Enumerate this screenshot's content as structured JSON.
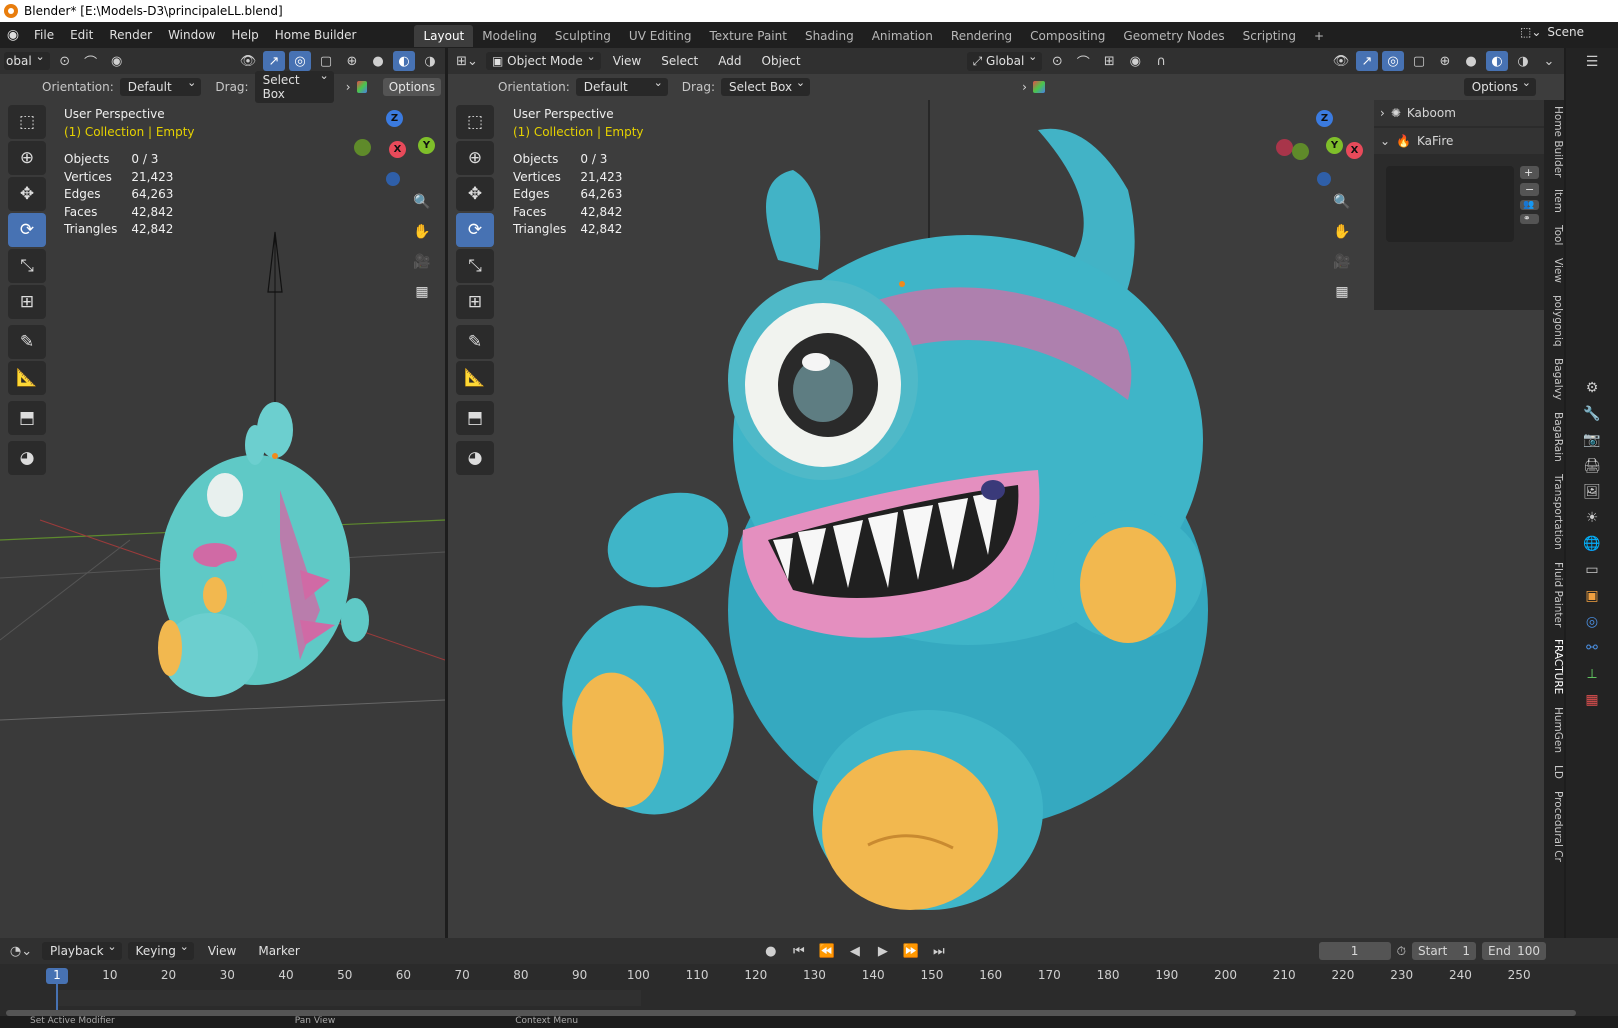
{
  "window": {
    "title": "Blender* [E:\\Models-D3\\principaleLL.blend]"
  },
  "menubar": {
    "items": [
      "File",
      "Edit",
      "Render",
      "Window",
      "Help",
      "Home Builder"
    ]
  },
  "workspaces": [
    "Layout",
    "Modeling",
    "Sculpting",
    "UV Editing",
    "Texture Paint",
    "Shading",
    "Animation",
    "Rendering",
    "Compositing",
    "Geometry Nodes",
    "Scripting"
  ],
  "active_workspace": "Layout",
  "scene": {
    "label": "Scene"
  },
  "left_viewport": {
    "header": {
      "global_partial": "obal"
    },
    "tool_header": {
      "orientation_label": "Orientation:",
      "orientation_value": "Default",
      "drag_label": "Drag:",
      "drag_value": "Select Box",
      "options": "Options"
    },
    "overlay": {
      "perspective": "User Perspective",
      "collection": "(1) Collection | Empty"
    },
    "stats": {
      "objects_label": "Objects",
      "objects": "0 / 3",
      "vertices_label": "Vertices",
      "vertices": "21,423",
      "edges_label": "Edges",
      "edges": "64,263",
      "faces_label": "Faces",
      "faces": "42,842",
      "triangles_label": "Triangles",
      "triangles": "42,842"
    },
    "gizmo": {
      "z": "Z",
      "y": "Y",
      "x": "X"
    }
  },
  "main_viewport": {
    "header": {
      "mode": "Object Mode",
      "menus": [
        "View",
        "Select",
        "Add",
        "Object"
      ],
      "transform": "Global"
    },
    "tool_header": {
      "orientation_label": "Orientation:",
      "orientation_value": "Default",
      "drag_label": "Drag:",
      "drag_value": "Select Box",
      "options": "Options"
    },
    "overlay": {
      "perspective": "User Perspective",
      "collection": "(1) Collection | Empty"
    },
    "stats": {
      "objects_label": "Objects",
      "objects": "0 / 3",
      "vertices_label": "Vertices",
      "vertices": "21,423",
      "edges_label": "Edges",
      "edges": "64,263",
      "faces_label": "Faces",
      "faces": "42,842",
      "triangles_label": "Triangles",
      "triangles": "42,842"
    },
    "gizmo": {
      "z": "Z",
      "y": "Y",
      "x": "X"
    }
  },
  "npanel": {
    "panels": [
      "Kaboom",
      "KaFire"
    ],
    "tabs": [
      "Home Builder",
      "Item",
      "Tool",
      "View",
      "polygoniq",
      "Bagalvy",
      "BagaRain",
      "Transportation",
      "Fluid Painter",
      "FRACTURE",
      "HumGen",
      "LD",
      "Procedural Cr"
    ]
  },
  "timeline": {
    "menus": {
      "playback": "Playback",
      "keying": "Keying",
      "view": "View",
      "marker": "Marker"
    },
    "current_frame": "1",
    "start_label": "Start",
    "start": "1",
    "end_label": "End",
    "end": "100",
    "ruler": [
      "1",
      "10",
      "20",
      "30",
      "40",
      "50",
      "60",
      "70",
      "80",
      "90",
      "100",
      "110",
      "120",
      "130",
      "140",
      "150",
      "160",
      "170",
      "180",
      "190",
      "200",
      "210",
      "220",
      "230",
      "240",
      "250"
    ]
  },
  "statusbar": {
    "items": [
      "Set Active Modifier",
      "Pan View",
      "Context Menu"
    ]
  },
  "colors": {
    "accent": "#4772b3",
    "collection_text": "#e6d200",
    "fur": "#3fb5c8",
    "pink": "#d46fa5",
    "feet": "#f2b84f"
  }
}
